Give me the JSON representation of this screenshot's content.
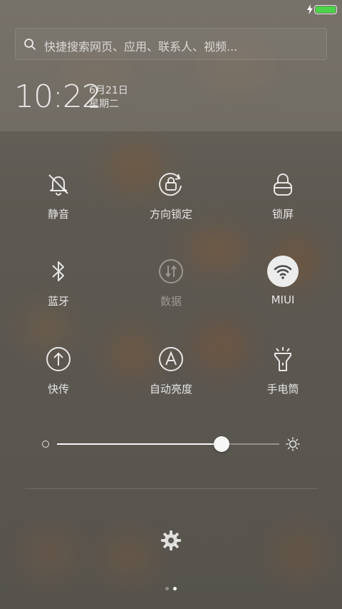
{
  "status_bar": {
    "charging_icon": "lightning-icon",
    "battery_level": 1.0,
    "battery_color": "#4bd34a"
  },
  "search": {
    "placeholder": "快捷搜索网页、应用、联系人、视频..."
  },
  "clock": {
    "time": "10:22",
    "date": "6月21日",
    "weekday": "星期二"
  },
  "toggles": [
    {
      "label": "静音",
      "icon": "bell-off-icon",
      "state": "off"
    },
    {
      "label": "方向锁定",
      "icon": "rotation-lock-icon",
      "state": "off"
    },
    {
      "label": "锁屏",
      "icon": "lock-icon",
      "state": "off"
    },
    {
      "label": "蓝牙",
      "icon": "bluetooth-icon",
      "state": "off"
    },
    {
      "label": "数据",
      "icon": "mobile-data-icon",
      "state": "disabled"
    },
    {
      "label": "MIUI",
      "icon": "wifi-icon",
      "state": "on"
    },
    {
      "label": "快传",
      "icon": "upload-icon",
      "state": "off"
    },
    {
      "label": "自动亮度",
      "icon": "auto-brightness-icon",
      "state": "off"
    },
    {
      "label": "手电筒",
      "icon": "flashlight-icon",
      "state": "off"
    }
  ],
  "brightness": {
    "level": 0.74,
    "min_icon": "dim-icon",
    "max_icon": "sun-icon"
  },
  "settings": {
    "icon": "gear-icon"
  },
  "pager": {
    "count": 2,
    "active": 1
  }
}
